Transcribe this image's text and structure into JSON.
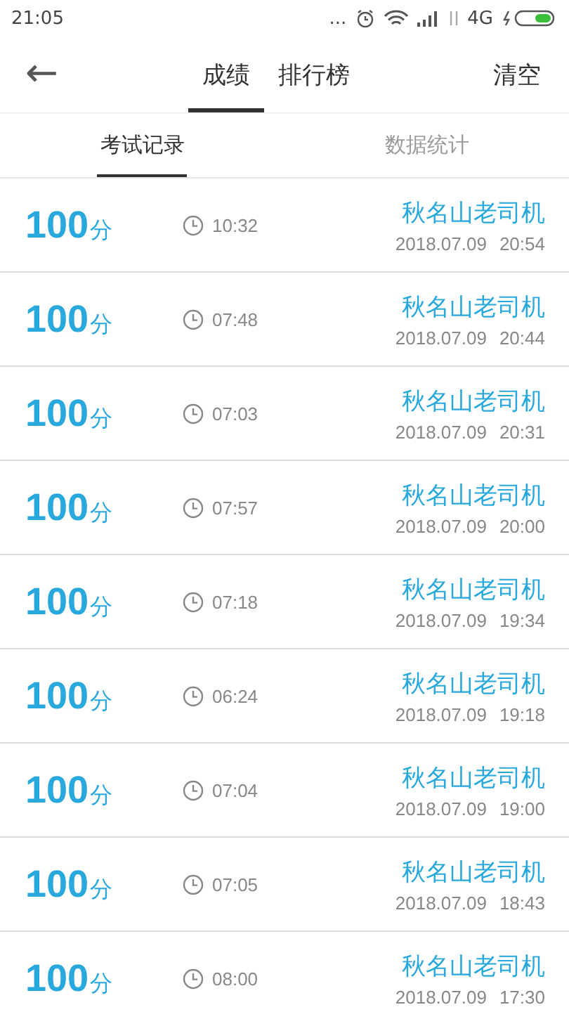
{
  "status_bar": {
    "time": "21:05",
    "dots": "...",
    "network": "4G"
  },
  "header": {
    "back": "←",
    "tabs": [
      {
        "label": "成绩",
        "selected": true
      },
      {
        "label": "排行榜",
        "selected": false
      }
    ],
    "action": "清空"
  },
  "sub_tabs": [
    {
      "label": "考试记录",
      "selected": true
    },
    {
      "label": "数据统计",
      "selected": false
    }
  ],
  "records": [
    {
      "score": "100",
      "unit": "分",
      "duration": "10:32",
      "name": "秋名山老司机",
      "date": "2018.07.09",
      "time": "20:54"
    },
    {
      "score": "100",
      "unit": "分",
      "duration": "07:48",
      "name": "秋名山老司机",
      "date": "2018.07.09",
      "time": "20:44"
    },
    {
      "score": "100",
      "unit": "分",
      "duration": "07:03",
      "name": "秋名山老司机",
      "date": "2018.07.09",
      "time": "20:31"
    },
    {
      "score": "100",
      "unit": "分",
      "duration": "07:57",
      "name": "秋名山老司机",
      "date": "2018.07.09",
      "time": "20:00"
    },
    {
      "score": "100",
      "unit": "分",
      "duration": "07:18",
      "name": "秋名山老司机",
      "date": "2018.07.09",
      "time": "19:34"
    },
    {
      "score": "100",
      "unit": "分",
      "duration": "06:24",
      "name": "秋名山老司机",
      "date": "2018.07.09",
      "time": "19:18"
    },
    {
      "score": "100",
      "unit": "分",
      "duration": "07:04",
      "name": "秋名山老司机",
      "date": "2018.07.09",
      "time": "19:00"
    },
    {
      "score": "100",
      "unit": "分",
      "duration": "07:05",
      "name": "秋名山老司机",
      "date": "2018.07.09",
      "time": "18:43"
    },
    {
      "score": "100",
      "unit": "分",
      "duration": "08:00",
      "name": "秋名山老司机",
      "date": "2018.07.09",
      "time": "17:30"
    }
  ]
}
